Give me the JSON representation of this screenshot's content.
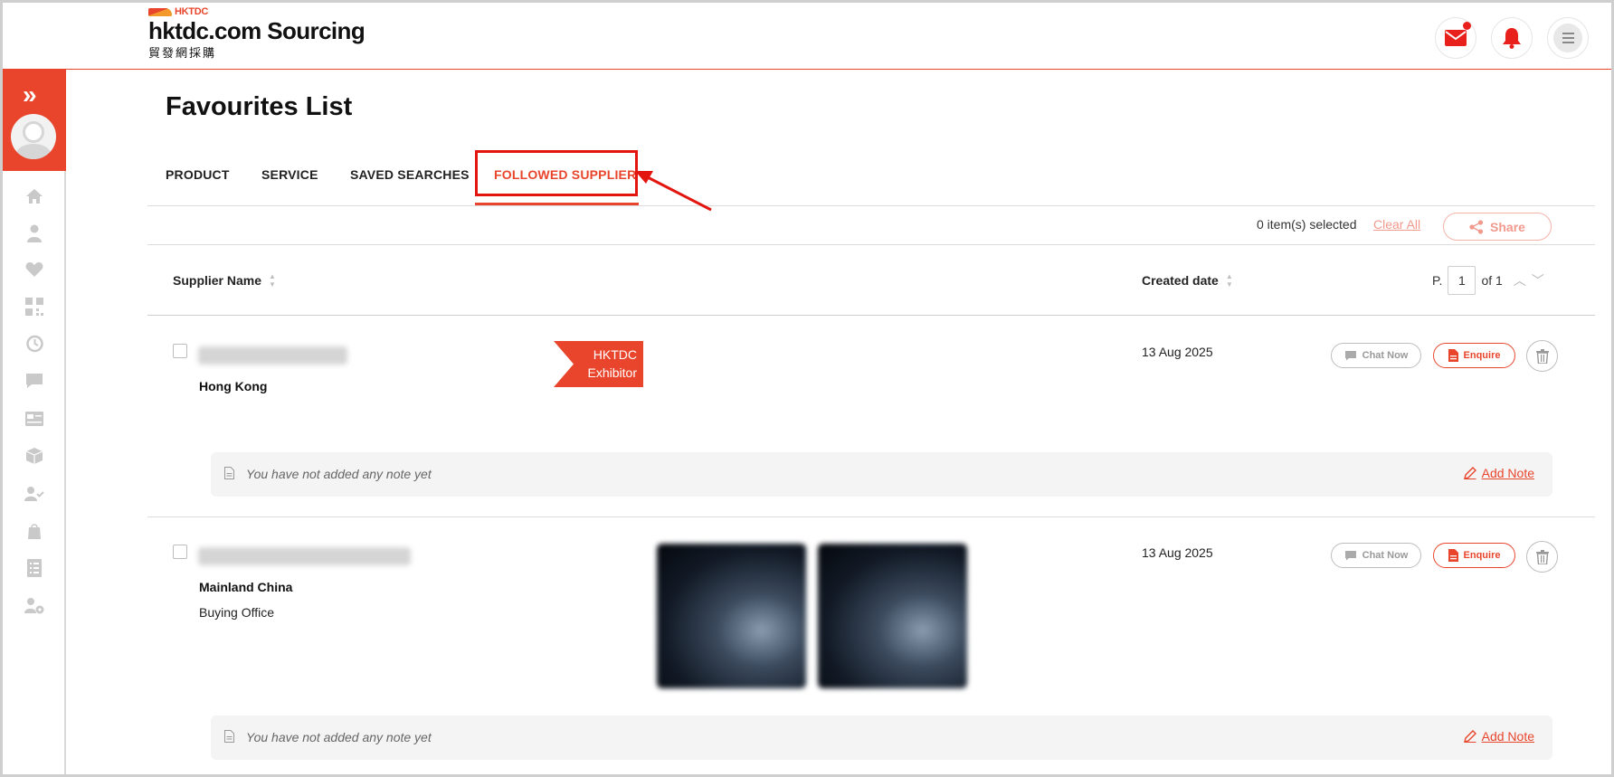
{
  "header": {
    "logo_top": "HKTDC",
    "logo_main": "hktdc.com Sourcing",
    "logo_sub": "貿發網採購"
  },
  "page": {
    "title": "Favourites List"
  },
  "tabs": [
    {
      "label": "PRODUCT",
      "active": false
    },
    {
      "label": "SERVICE",
      "active": false
    },
    {
      "label": "SAVED SEARCHES",
      "active": false
    },
    {
      "label": "FOLLOWED SUPPLIER",
      "active": true
    }
  ],
  "selection": {
    "count_text": "0 item(s) selected",
    "clear_all": "Clear All",
    "share": "Share"
  },
  "table": {
    "col_supplier": "Supplier Name",
    "col_date": "Created date",
    "pager_prefix": "P.",
    "page": "1",
    "pager_total": "of 1"
  },
  "rows": [
    {
      "region": "Hong Kong",
      "subtype": "",
      "badge_line1": "HKTDC",
      "badge_line2": "Exhibitor",
      "date": "13 Aug 2025",
      "chat": "Chat Now",
      "enquire": "Enquire",
      "note": "You have not added any note yet",
      "add_note": "Add Note"
    },
    {
      "region": "Mainland China",
      "subtype": "Buying Office",
      "date": "13 Aug 2025",
      "chat": "Chat Now",
      "enquire": "Enquire",
      "note": "You have not added any note yet",
      "add_note": "Add Note"
    }
  ],
  "colors": {
    "brand": "#e8452c",
    "highlight": "#e3160f"
  },
  "icons": [
    "mail-icon",
    "bell-icon",
    "menu-icon",
    "expand-icon",
    "home-icon",
    "user-icon",
    "heart-icon",
    "qr-icon",
    "history-icon",
    "chat-icon",
    "card-icon",
    "box-icon",
    "user-check-icon",
    "bag-icon",
    "list-icon",
    "user-settings-icon",
    "share-icon",
    "trash-icon",
    "note-icon",
    "pencil-icon"
  ]
}
